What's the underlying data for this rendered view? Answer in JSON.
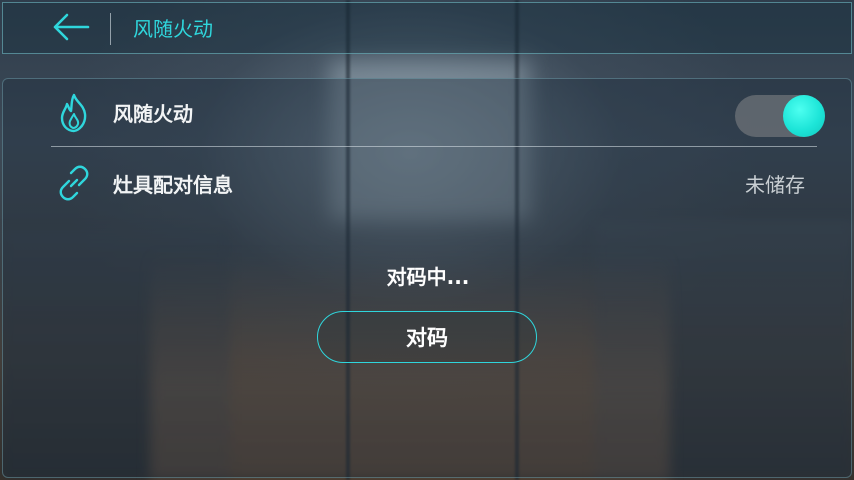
{
  "header": {
    "title": "风随火动",
    "back_icon": "arrow-left-icon"
  },
  "settings": {
    "fire_follow": {
      "label": "风随火动",
      "icon": "flame-icon",
      "toggle_on": true
    },
    "stove_pairing": {
      "label": "灶具配对信息",
      "icon": "link-icon",
      "value": "未储存"
    }
  },
  "pairing": {
    "status": "对码中...",
    "button_label": "对码"
  },
  "colors": {
    "accent": "#2fd6dc",
    "toggle_knob": "#1de5d8"
  }
}
